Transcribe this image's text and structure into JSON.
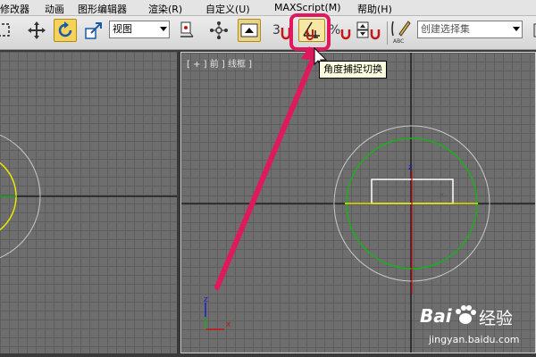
{
  "menu": {
    "items": [
      "修改器",
      "动画",
      "图形编辑器",
      "渲染(R)",
      "自定义(U)",
      "MAXScript(M)",
      "帮助(H)"
    ]
  },
  "toolbar": {
    "view_dropdown": "视图",
    "selection_set_dropdown": "创建选择集",
    "snap_label": "3",
    "percent_label": "%",
    "abc_label": "ABC"
  },
  "tooltip": {
    "text": "角度捕捉切换"
  },
  "viewports": {
    "front_label": "[ + ] 前 ] 线框 ]",
    "axis_z": "z",
    "axis_x": "x"
  },
  "watermark": {
    "brand_left": "Bai",
    "brand_right": "经验",
    "url": "jingyan.baidu.com"
  },
  "colors": {
    "highlight": "#e0195e",
    "active_button": "#f4d35a",
    "circle_green": "#19b019",
    "axis_yellow": "#e8e800",
    "axis_red": "#c81414"
  }
}
